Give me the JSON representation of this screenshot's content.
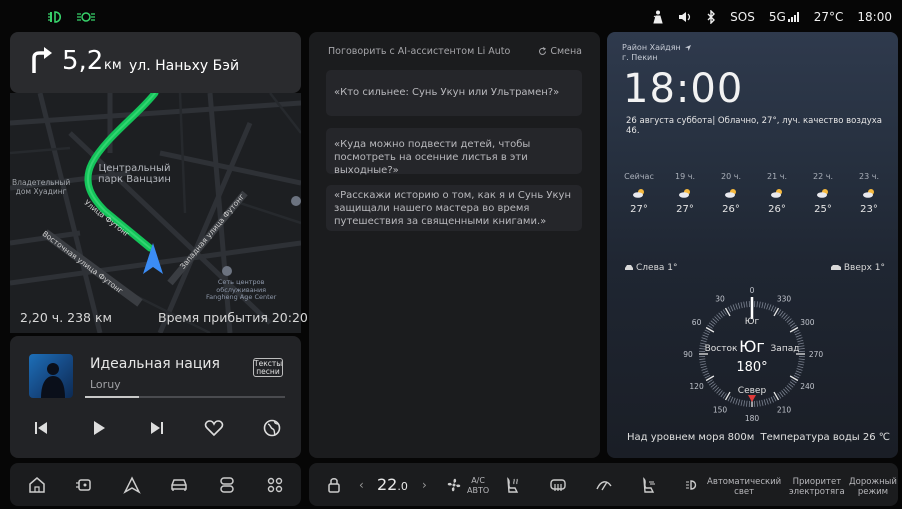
{
  "status_bar": {
    "left_icons": [
      "headlight-icon",
      "parking-light-icon"
    ],
    "sos": "SOS",
    "network": "5G",
    "temperature": "27°C",
    "time": "18:00",
    "icons": [
      "seatbelt-icon",
      "volume-icon",
      "bluetooth-icon",
      "signal-icon"
    ]
  },
  "navigation": {
    "distance": "5,2",
    "distance_unit": "км",
    "street": "ул. Наньху Бэй",
    "turn": "right",
    "map_labels": {
      "park": "Центральный\nпарк Ванцзин",
      "building": "Владетельный\nдом Хуадинг",
      "street_main": "Улица Футонг",
      "street_east": "Восточная улица Футонг",
      "street_west": "Западная улица Футонг",
      "service": "Сеть центров\nобслуживания\nFangheng Age Center"
    },
    "eta_info": "2,20 ч. 238 км",
    "arrival": "Время прибытия 20:20"
  },
  "music": {
    "title": "Идеальная нация",
    "artist": "Loruy",
    "lyrics_button": "Тексты песни",
    "progress": 0.27,
    "controls": [
      "previous-icon",
      "play-icon",
      "next-icon",
      "heart-icon",
      "globe-icon"
    ]
  },
  "ai_assistant": {
    "title": "Поговорить с AI-ассистентом Li Auto",
    "change_label": "Смена",
    "suggestions": [
      "«Кто сильнее: Сунь Укун или Ультрамен?»",
      "«Куда можно подвести детей, чтобы посмотреть на осенние листья в эти выходные?»",
      "«Расскажи историю о том, как я и Сунь Укун защищали нашего мастера во время путешествия за священными книгами.»"
    ]
  },
  "weather": {
    "region": "Район Хайдян",
    "city": "г. Пекин",
    "time": "18:00",
    "info": "26 августа  суббота| Облачно, 27°, луч. качество воздуха 46.",
    "hourly": [
      {
        "label": "Сейчас",
        "temp": "27°"
      },
      {
        "label": "19 ч.",
        "temp": "27°"
      },
      {
        "label": "20 ч.",
        "temp": "26°"
      },
      {
        "label": "21 ч.",
        "temp": "26°"
      },
      {
        "label": "22 ч.",
        "temp": "25°"
      },
      {
        "label": "23 ч.",
        "temp": "23°"
      }
    ],
    "wind_left": "Слева 1°",
    "wind_right": "Вверх 1°",
    "compass": {
      "heading_label": "Юг",
      "heading_degrees": "180°",
      "south": "Юг",
      "north": "Север",
      "east": "Восток",
      "west": "Запад",
      "ticks": [
        "0",
        "30",
        "60",
        "90",
        "120",
        "150",
        "180",
        "210",
        "240",
        "270",
        "300",
        "330"
      ]
    },
    "altitude": "Над уровнем моря 800м",
    "water_temp": "Температура воды  26 ℃"
  },
  "dock_left": {
    "icons": [
      "home-icon",
      "car-view-icon",
      "navigation-icon",
      "vehicle-icon",
      "media-icon",
      "apps-icon"
    ]
  },
  "dock_right": {
    "temp_value": "22",
    "temp_decimal": ".0",
    "ac_label": "A/C",
    "auto_label": "АВТО",
    "auto_light": "Автоматический\nсвет",
    "electric_priority": "Приоритет\nэлектротяга",
    "road_mode": "Дорожный\nрежим"
  }
}
